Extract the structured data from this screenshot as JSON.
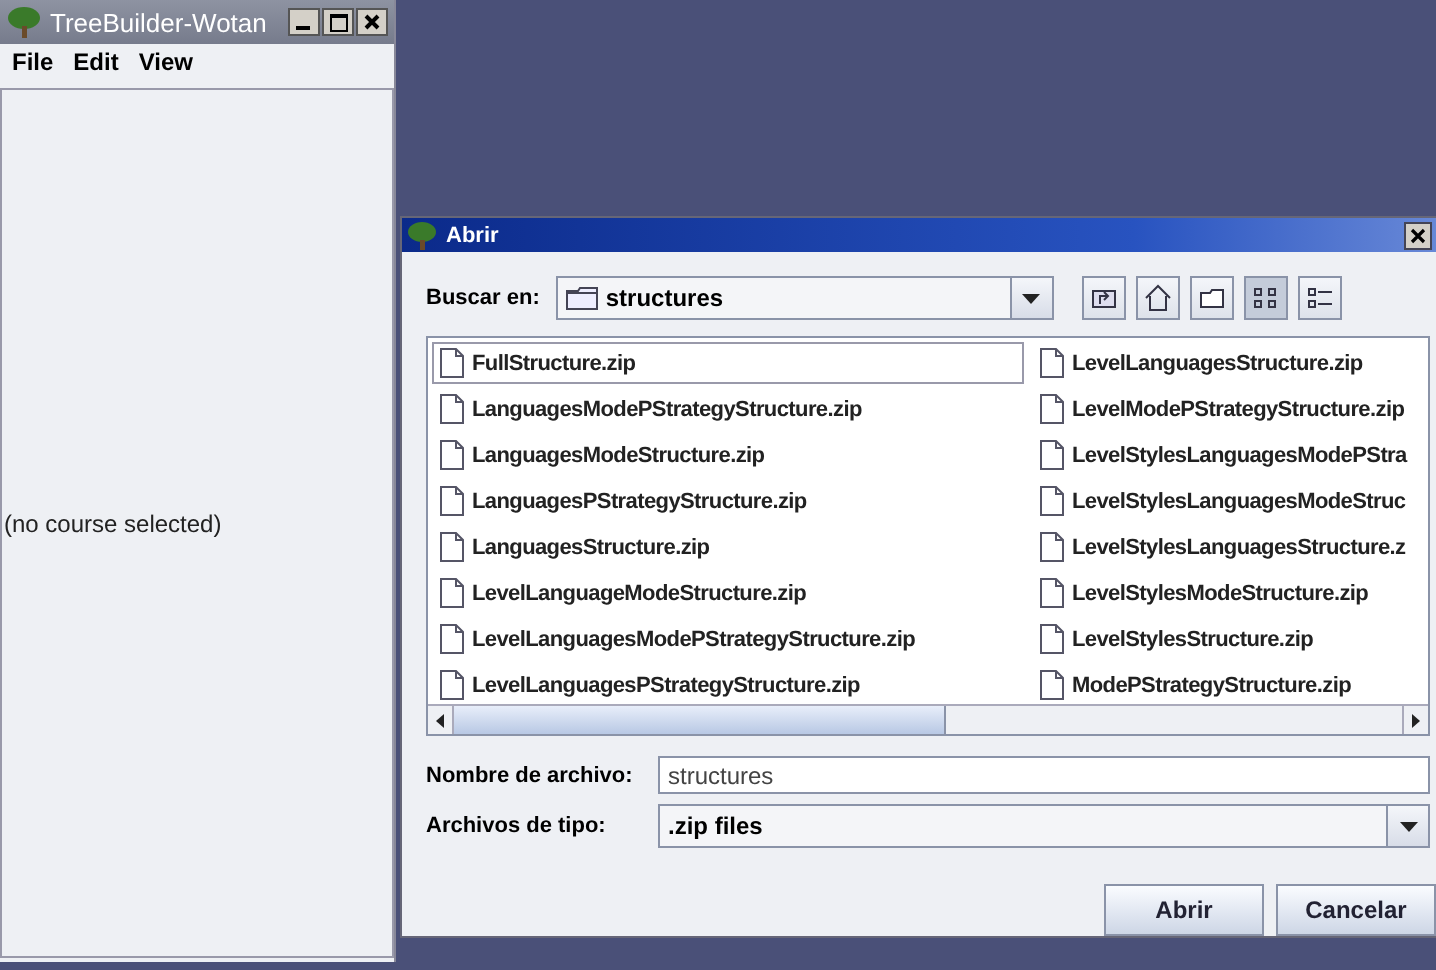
{
  "main_window": {
    "title": "TreeBuilder-Wotan",
    "active": false,
    "menu": [
      "File",
      "Edit",
      "View"
    ],
    "status_text": "(no course selected)"
  },
  "dialog": {
    "title": "Abrir",
    "look_in_label": "Buscar en:",
    "look_in_value": "structures",
    "view_buttons": [
      {
        "kind": "up",
        "selected": false
      },
      {
        "kind": "home",
        "selected": false
      },
      {
        "kind": "new-folder",
        "selected": false
      },
      {
        "kind": "list",
        "selected": true
      },
      {
        "kind": "details",
        "selected": false
      }
    ],
    "files": [
      {
        "name": "FullStructure.zip",
        "selected": true
      },
      {
        "name": "LanguagesModePStrategyStructure.zip",
        "selected": false
      },
      {
        "name": "LanguagesModeStructure.zip",
        "selected": false
      },
      {
        "name": "LanguagesPStrategyStructure.zip",
        "selected": false
      },
      {
        "name": "LanguagesStructure.zip",
        "selected": false
      },
      {
        "name": "LevelLanguageModeStructure.zip",
        "selected": false
      },
      {
        "name": "LevelLanguagesModePStrategyStructure.zip",
        "selected": false
      },
      {
        "name": "LevelLanguagesPStrategyStructure.zip",
        "selected": false
      },
      {
        "name": "LevelLanguagesStructure.zip",
        "selected": false
      },
      {
        "name": "LevelModePStrategyStructure.zip",
        "selected": false
      },
      {
        "name": "LevelStylesLanguagesModePStra",
        "selected": false
      },
      {
        "name": "LevelStylesLanguagesModeStruc",
        "selected": false
      },
      {
        "name": "LevelStylesLanguagesStructure.z",
        "selected": false
      },
      {
        "name": "LevelStylesModeStructure.zip",
        "selected": false
      },
      {
        "name": "LevelStylesStructure.zip",
        "selected": false
      },
      {
        "name": "ModePStrategyStructure.zip",
        "selected": false
      }
    ],
    "file_name_label": "Nombre de archivo:",
    "file_name_value": "structures",
    "file_type_label": "Archivos de tipo:",
    "file_type_value": ".zip files",
    "buttons": [
      "Abrir",
      "Cancelar"
    ]
  }
}
